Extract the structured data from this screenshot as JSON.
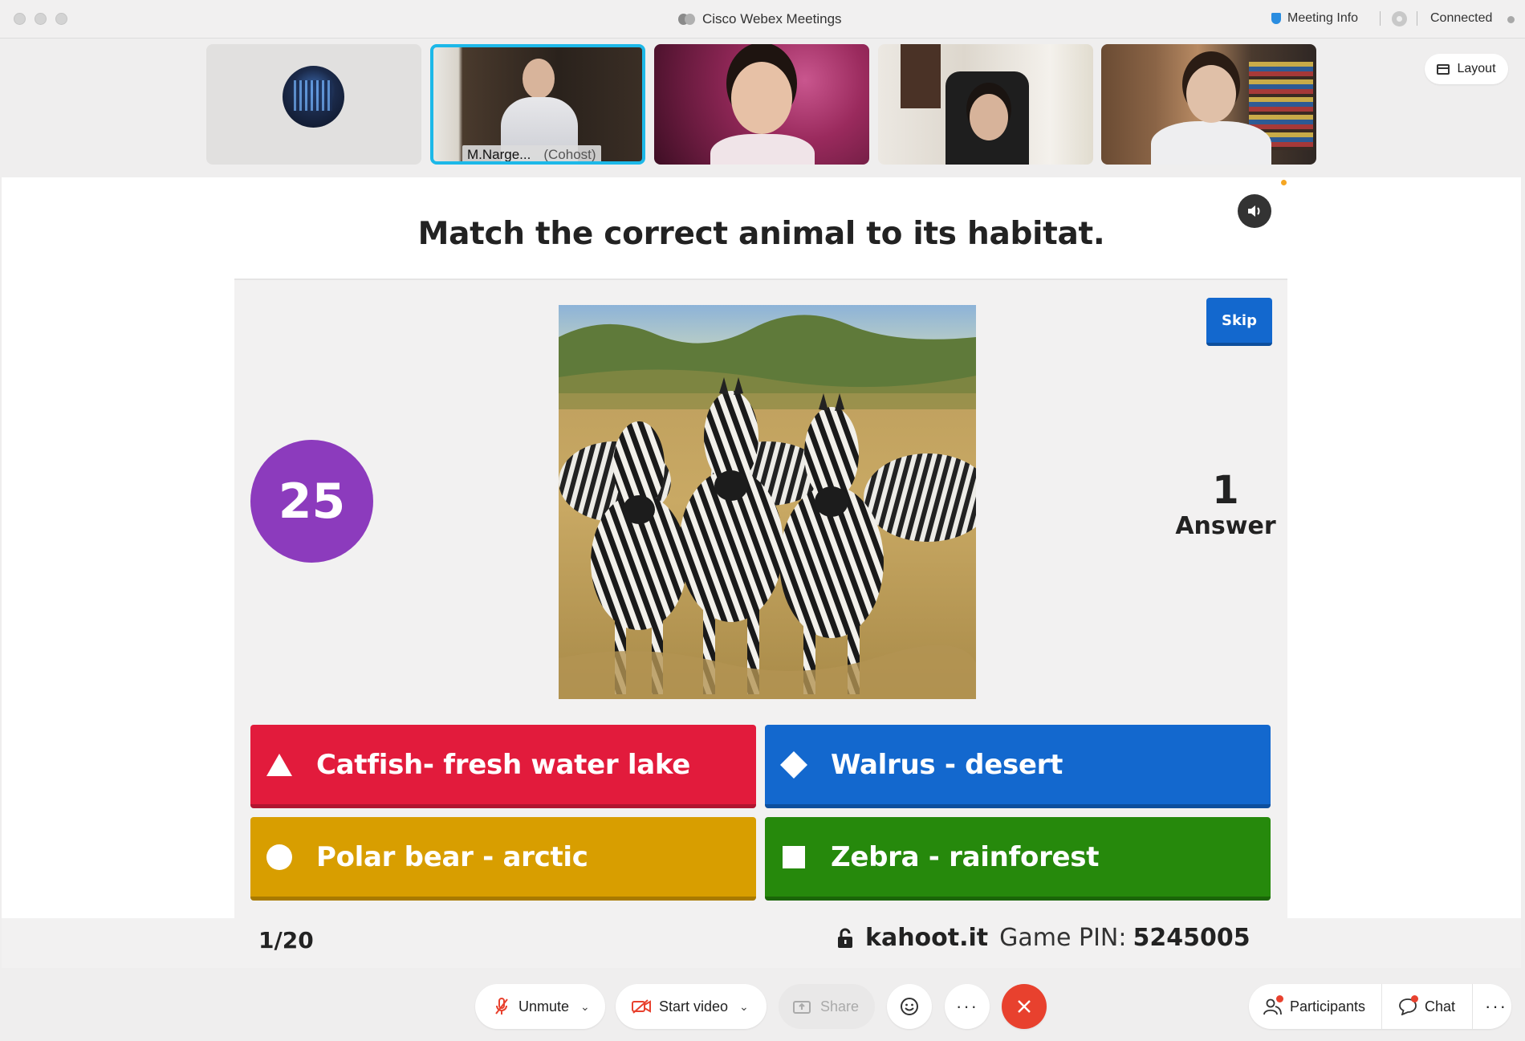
{
  "window": {
    "app_title": "Cisco Webex Meetings",
    "meeting_info": "Meeting Info",
    "status": "Connected"
  },
  "video_strip": {
    "participants": [
      {
        "name": "M.Narge...",
        "role": "(Cohost)"
      }
    ],
    "layout_label": "Layout",
    "active_speaker_border": "#1db8e8"
  },
  "quiz": {
    "question": "Match the correct animal to its habitat.",
    "skip_label": "Skip",
    "timer": "25",
    "answers_count": "1",
    "answers_label": "Answer",
    "image": "zebras-in-grassland",
    "options": [
      {
        "shape": "triangle-icon",
        "text": "Catfish- fresh water lake",
        "color": "#e21b3c"
      },
      {
        "shape": "diamond-icon",
        "text": "Walrus - desert",
        "color": "#1368ce"
      },
      {
        "shape": "circle-icon",
        "text": "Polar bear - arctic",
        "color": "#d89e00"
      },
      {
        "shape": "square-icon",
        "text": "Zebra - rainforest",
        "color": "#26890c"
      }
    ],
    "question_counter": "1/20",
    "site": "kahoot.it",
    "pin_label": "Game PIN:",
    "pin": "5245005"
  },
  "controls": {
    "unmute": "Unmute",
    "start_video": "Start video",
    "share": "Share",
    "participants": "Participants",
    "chat": "Chat",
    "end_color": "#e8412e"
  }
}
